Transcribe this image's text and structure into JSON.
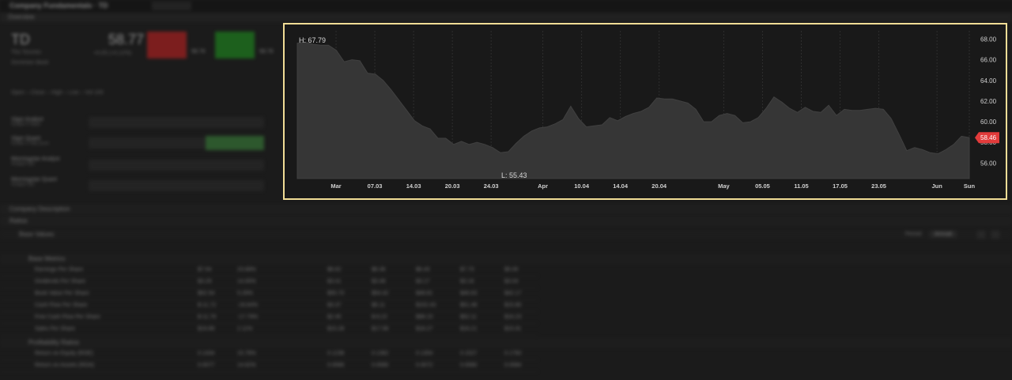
{
  "app": {
    "window_title": "Company Fundamentals · TD",
    "tab": "Overview"
  },
  "quote": {
    "ticker": "TD",
    "company": "The Toronto-",
    "company_line2": "Dominion Bank",
    "price": "58.77",
    "price_sub": "+0.05 (+0.12%)",
    "sell_label": "SELL",
    "buy_label": "BUY",
    "sell_price": "58.76",
    "buy_price": "58.78",
    "ohl": "Open –   Close –   High –   Low –   Vol  100"
  },
  "left_rows": [
    {
      "label": "Vigor Analyst",
      "sub": "Grade 5 Stars"
    },
    {
      "label": "Vigor Quant",
      "sub": "Grade 1 Star pure"
    },
    {
      "label": "Morningstar Analyst",
      "sub": "Analyst QC"
    },
    {
      "label": "Morningstar Quant",
      "sub": "Analyst QC"
    }
  ],
  "sections": {
    "company_description": "Company Description",
    "ratios": "Ratios",
    "base_values": "Base Values",
    "base_metrics": "Base Metrics",
    "profitability": "Profitability Ratios",
    "period_label": "Period",
    "period_value": "Annual"
  },
  "table_rows": [
    {
      "name": "Earnings Per Share",
      "vals": [
        "$7.54",
        "23.68%",
        "$6.62",
        "$6.36",
        "$6.43",
        "$7.73",
        "$5.00"
      ]
    },
    {
      "name": "Dividends Per Share",
      "vals": [
        "$3.29",
        "14.00%",
        "$3.41",
        "$3.48",
        "$3.17",
        "$3.16",
        "$3.04"
      ]
    },
    {
      "name": "Book Value Per Share",
      "vals": [
        "$52.54",
        "5.29%",
        "$55.70",
        "$54.42",
        "$48.81",
        "$46.63",
        "$42.17"
      ]
    },
    {
      "name": "Cash Flow Per Share",
      "vals": [
        "$-11.72",
        "-16.64%",
        "$3.37",
        "$6.11",
        "$102.43",
        "$51.48",
        "$15.80"
      ]
    },
    {
      "name": "Free Cash Flow Per Share",
      "vals": [
        "$-11.76",
        "-17.79%",
        "$2.45",
        "$-6.22",
        "$98.15",
        "$52.11",
        "$16.23"
      ]
    },
    {
      "name": "Sales Per Share",
      "vals": [
        "$19.89",
        "2.11%",
        "$15.28",
        "$17.58",
        "$18.27",
        "$16.21",
        "$15.91"
      ]
    },
    {
      "name": "Return on Equity (ROE)",
      "vals": [
        "0.1434",
        "15.78%",
        "0.1238",
        "0.1362",
        "0.1304",
        "0.1527",
        "0.1760"
      ]
    },
    {
      "name": "Return on Assets (ROA)",
      "vals": [
        "0.0077",
        "14.62%",
        "0.0066",
        "0.0080",
        "0.0072",
        "0.0080",
        "0.0084"
      ]
    }
  ],
  "chart_data": {
    "type": "area",
    "high_label": "H: 67.79",
    "low_label": "L: 55.43",
    "last_label": "58.46",
    "ylim": [
      54.5,
      68.8
    ],
    "yticks": [
      "56.00",
      "58.00",
      "60.00",
      "62.00",
      "64.00",
      "66.00",
      "68.00"
    ],
    "yticks_values": [
      56,
      58,
      60,
      62,
      64,
      66,
      68
    ],
    "xticks": [
      "Mar",
      "07.03",
      "14.03",
      "20.03",
      "24.03",
      "Apr",
      "10.04",
      "14.04",
      "20.04",
      "May",
      "05.05",
      "11.05",
      "17.05",
      "23.05",
      "Jun",
      "Sun"
    ],
    "xticks_index": [
      6,
      12,
      18,
      24,
      30,
      38,
      44,
      50,
      56,
      66,
      72,
      78,
      84,
      90,
      99,
      104
    ],
    "grid": true,
    "series": [
      {
        "values": [
          67.6,
          67.7,
          67.5,
          67.4,
          67.4,
          66.9,
          65.8,
          66.0,
          65.9,
          64.7,
          64.6,
          64.0,
          63.1,
          62.1,
          61.1,
          60.1,
          59.6,
          59.3,
          58.4,
          58.4,
          57.8,
          58.1,
          57.8,
          58.0,
          57.8,
          57.5,
          57.0,
          57.1,
          57.9,
          58.6,
          59.1,
          59.4,
          59.5,
          59.8,
          60.2,
          61.5,
          60.3,
          59.5,
          59.6,
          59.7,
          60.4,
          60.1,
          60.5,
          60.8,
          61.0,
          61.4,
          62.3,
          62.2,
          62.2,
          62.0,
          61.8,
          61.2,
          60.0,
          60.0,
          60.6,
          60.8,
          60.6,
          59.9,
          60.0,
          60.4,
          61.3,
          62.4,
          61.9,
          61.3,
          60.9,
          61.4,
          61.0,
          60.9,
          61.6,
          60.6,
          61.2,
          61.1,
          61.1,
          61.2,
          61.3,
          61.2,
          60.3,
          58.8,
          57.2,
          57.5,
          57.3,
          57.0,
          56.9,
          57.3,
          57.8,
          58.6,
          58.46
        ]
      }
    ]
  }
}
